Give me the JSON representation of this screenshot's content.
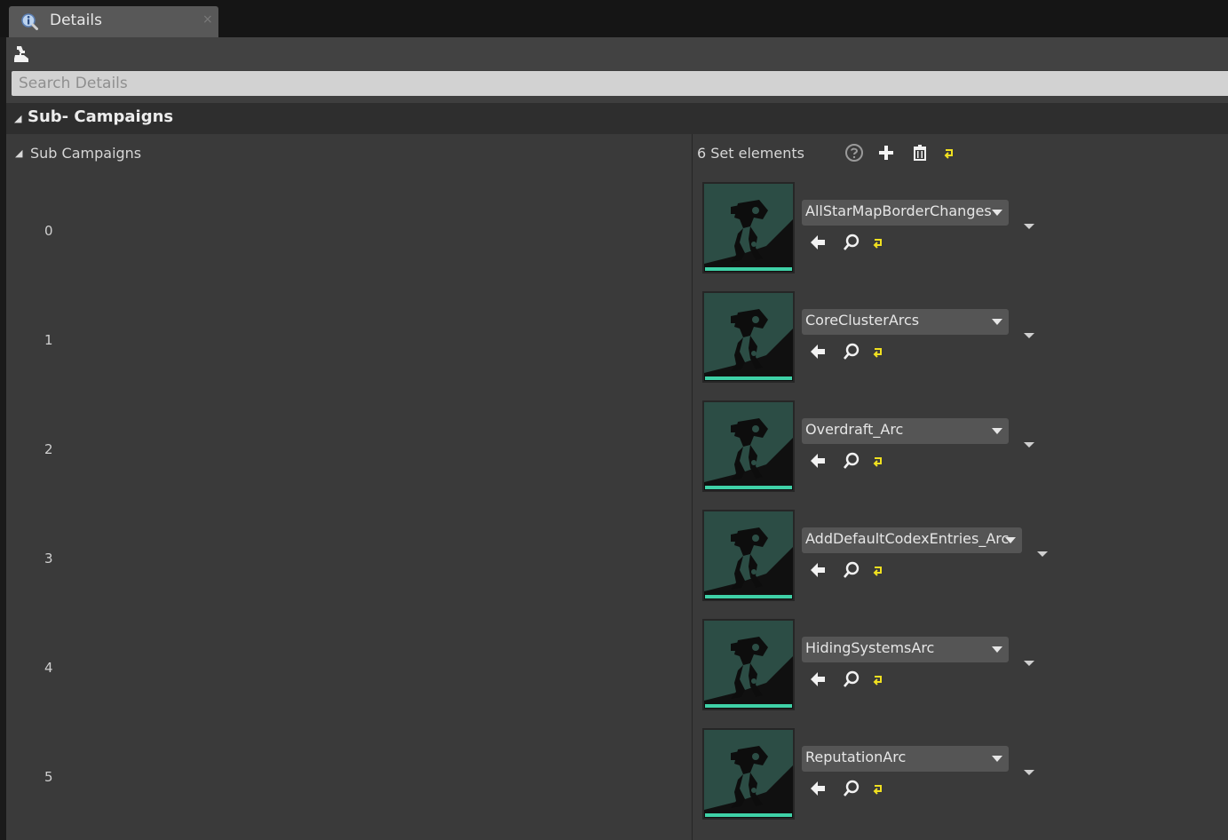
{
  "tab": {
    "title": "Details",
    "close": "×"
  },
  "search": {
    "placeholder": "Search Details"
  },
  "category": {
    "title": "Sub- Campaigns"
  },
  "property": {
    "label": "Sub Campaigns",
    "count_label": "6 Set elements"
  },
  "icons": {
    "tab": "info-icon",
    "toolbar": "lock-icon",
    "help": "question-circle-icon",
    "add": "plus-icon",
    "clear": "trash-icon",
    "reset": "reset-arrow-icon",
    "use": "left-arrow-icon",
    "browse": "magnifier-icon"
  },
  "colors": {
    "accent": "#3fd1a7",
    "reset": "#f0e020",
    "thumb_bg": "#2c4d45"
  },
  "elements": [
    {
      "index": "0",
      "value": "AllStarMapBorderChanges"
    },
    {
      "index": "1",
      "value": "CoreClusterArcs"
    },
    {
      "index": "2",
      "value": "Overdraft_Arc"
    },
    {
      "index": "3",
      "value": "AddDefaultCodexEntries_Arc"
    },
    {
      "index": "4",
      "value": "HidingSystemsArc"
    },
    {
      "index": "5",
      "value": "ReputationArc"
    }
  ]
}
